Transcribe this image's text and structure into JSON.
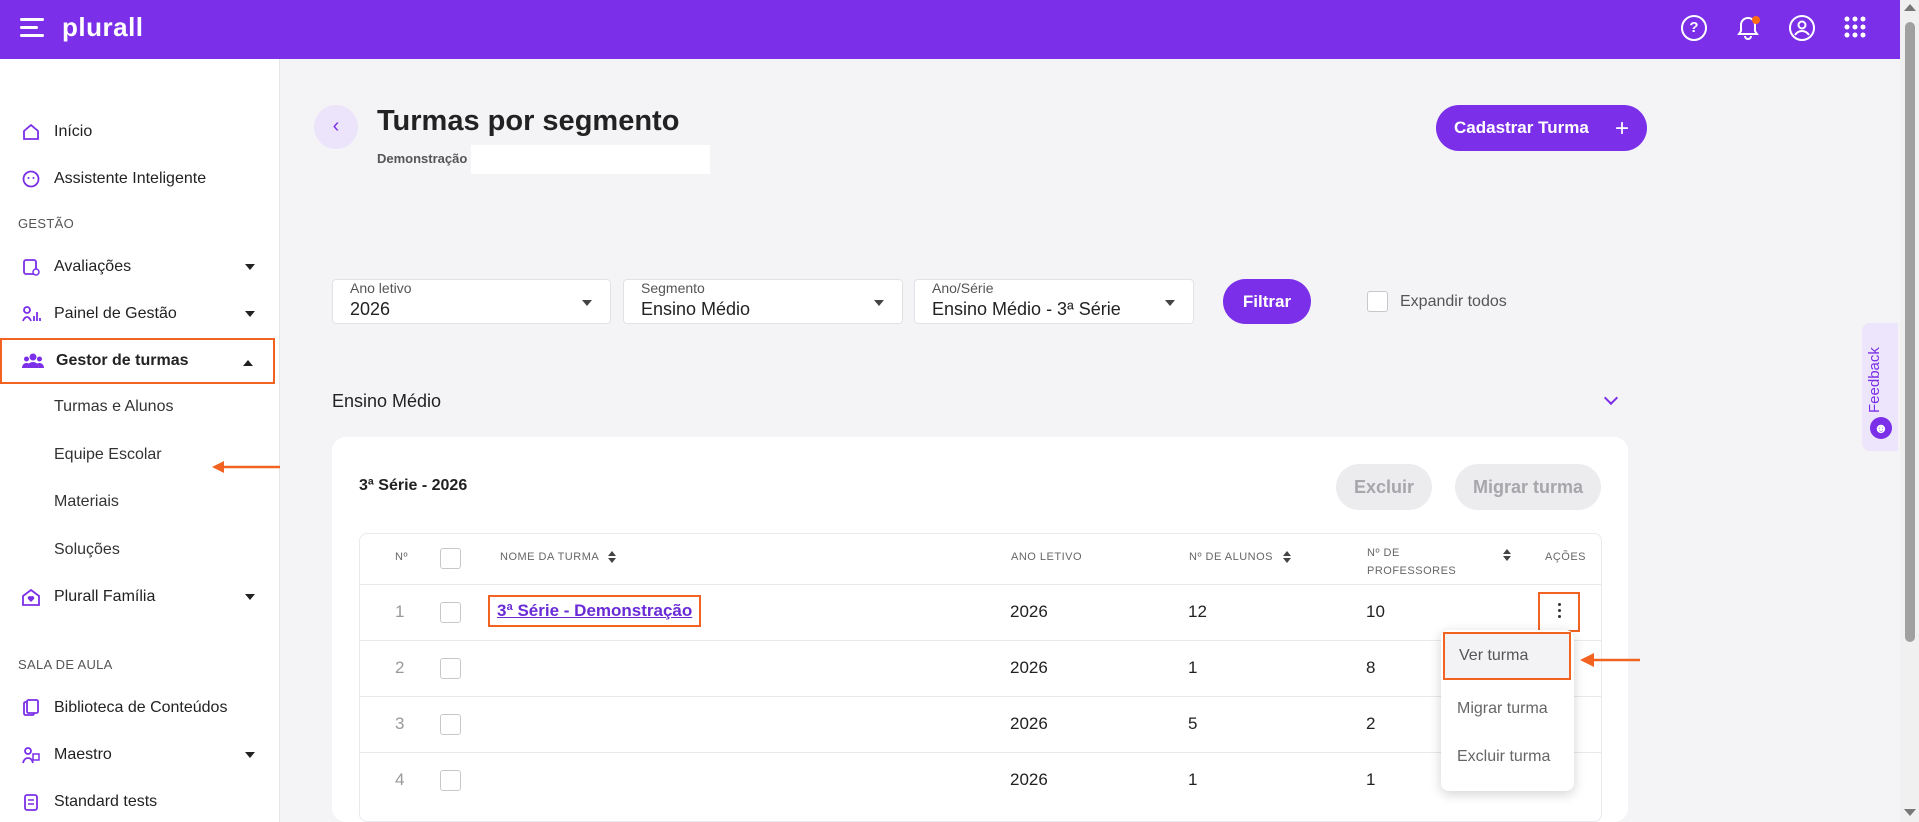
{
  "header": {
    "logo": "plurall",
    "help_glyph": "?",
    "icons": [
      "menu-icon",
      "help-icon",
      "bell-icon",
      "user-icon",
      "apps-icon"
    ]
  },
  "sidebar": {
    "items": [
      {
        "label": "Início",
        "icon": "home-icon"
      },
      {
        "label": "Assistente Inteligente",
        "icon": "assistant-icon"
      }
    ],
    "section_gestao": "GESTÃO",
    "gestao_items": [
      {
        "label": "Avaliações",
        "icon": "evaluation-icon"
      },
      {
        "label": "Painel de Gestão",
        "icon": "dashboard-icon"
      },
      {
        "label": "Gestor de turmas",
        "icon": "users-icon"
      }
    ],
    "sub_items": [
      "Turmas e Alunos",
      "Equipe Escolar",
      "Materiais",
      "Soluções"
    ],
    "familia": "Plurall Família",
    "section_sala": "SALA DE AULA",
    "sala_items": [
      {
        "label": "Biblioteca de Conteúdos",
        "icon": "library-icon"
      },
      {
        "label": "Maestro",
        "icon": "maestro-icon"
      },
      {
        "label": "Standard tests",
        "icon": "tests-icon"
      }
    ]
  },
  "page": {
    "back_glyph": "‹",
    "title": "Turmas por segmento",
    "subtitle": "Demonstração",
    "cadastrar_label": "Cadastrar Turma",
    "cadastrar_glyph": "+"
  },
  "filters": {
    "ano_letivo": {
      "label": "Ano letivo",
      "value": "2026"
    },
    "segmento": {
      "label": "Segmento",
      "value": "Ensino Médio"
    },
    "ano_serie": {
      "label": "Ano/Série",
      "value": "Ensino Médio - 3ª Série"
    },
    "filtrar_label": "Filtrar",
    "expandir_label": "Expandir todos"
  },
  "segment": {
    "title": "Ensino Médio",
    "card_title": "3ª Série - 2026",
    "excluir_label": "Excluir",
    "migrar_label": "Migrar turma"
  },
  "table": {
    "headers": {
      "num": "Nº",
      "nome": "NOME DA TURMA",
      "ano": "ANO LETIVO",
      "alunos": "Nº DE ALUNOS",
      "professores_1": "Nº DE",
      "professores_2": "PROFESSORES",
      "acoes": "AÇÕES"
    },
    "rows": [
      {
        "num": "1",
        "nome": "3ª Série - Demonstração",
        "ano": "2026",
        "alunos": "12",
        "professores": "10"
      },
      {
        "num": "2",
        "nome": "",
        "ano": "2026",
        "alunos": "1",
        "professores": "8"
      },
      {
        "num": "3",
        "nome": "",
        "ano": "2026",
        "alunos": "5",
        "professores": "2"
      },
      {
        "num": "4",
        "nome": "",
        "ano": "2026",
        "alunos": "1",
        "professores": "1"
      }
    ]
  },
  "actions_menu": [
    "Ver turma",
    "Migrar turma",
    "Excluir turma"
  ],
  "feedback": {
    "label": "Feedback",
    "smile_glyph": "☻"
  },
  "colors": {
    "brand": "#7b2fe8",
    "highlight": "#f26322"
  }
}
